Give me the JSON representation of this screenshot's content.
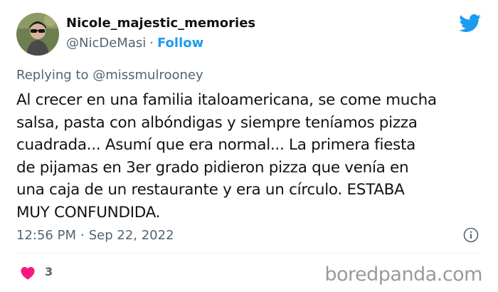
{
  "tweet": {
    "display_name": "Nicole_majestic_memories",
    "handle": "@NicDeMasi",
    "separator": "·",
    "follow_label": "Follow",
    "replying_prefix": "Replying to",
    "replying_to": "@missmulrooney",
    "text": "Al crecer en una familia italoamericana, se come mucha\nsalsa, pasta con albóndigas y siempre teníamos pizza\ncuadrada... Asumí que era normal... La primera fiesta\nde pijamas en 3er grado pidieron pizza que venía en\nuna caja de un restaurante y era un círculo. ESTABA\nMUY CONFUNDIDA.",
    "time": "12:56 PM",
    "date": "Sep 22, 2022",
    "like_count": "3"
  },
  "icons": {
    "avatar": "avatar-photo",
    "brand": "twitter-bird-icon",
    "info": "info-icon",
    "like": "heart-icon"
  },
  "colors": {
    "accent": "#1d9bf0",
    "like": "#f91880",
    "secondary_text": "#536471"
  },
  "watermark": "boredpanda.com"
}
